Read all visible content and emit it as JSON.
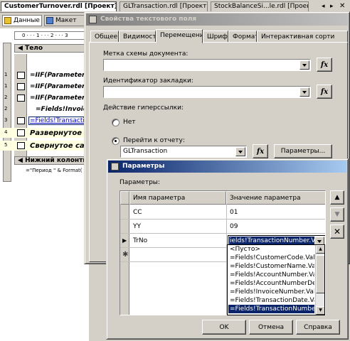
{
  "doc_tabs": [
    "CustomerTurnover.rdl [Проект]",
    "GLTransaction.rdl [Проект]",
    "StockBalanceSi...le.rdl [Проект]"
  ],
  "designer_tabs": [
    "Данные",
    "Макет"
  ],
  "ruler_text": "0 · · · 1 · · · 2 · · · 3",
  "report": {
    "body_label": "Тело",
    "rows": [
      "=IIF(Parameters!C",
      "=IIF(Parameters.",
      "=IIF(Parameters!C",
      "=Fields!InvoiceN",
      "=Fields!Transaction",
      "Развернутое с",
      "Свернутое са"
    ],
    "footer_label": "Нижний колонтит",
    "footer_expr": "=\"Период \" & Format("
  },
  "dialog1": {
    "title": "Свойства текстового поля",
    "tabs": [
      "Общее",
      "Видимость",
      "Перемещение",
      "Шрифт",
      "Формат",
      "Интерактивная сорти"
    ],
    "doc_map_label": "Метка схемы документа:",
    "bookmark_label": "Идентификатор закладки:",
    "hyperlink_label": "Действие гиперссылки:",
    "radio_none": "Нет",
    "radio_goto": "Перейти к отчету:",
    "report_value": "GLTransaction",
    "params_button": "Параметры..."
  },
  "dialog2": {
    "title": "Параметры",
    "params_label": "Параметры:",
    "col_name": "Имя параметра",
    "col_value": "Значение параметра",
    "rows": [
      {
        "name": "CC",
        "value": "01"
      },
      {
        "name": "YY",
        "value": "09"
      },
      {
        "name": "TrNo",
        "value": "ields!TransactionNumber.Value"
      }
    ],
    "dropdown_items": [
      "<Пусто>",
      "=Fields!CustomerCode.Value",
      "=Fields!CustomerName.Value",
      "=Fields!AccountNumber.Value",
      "=Fields!AccountNumberDescripti",
      "=Fields!InvoiceNumber.Value",
      "=Fields!TransactionDate.Value",
      "=Fields!TransactionNumber.Valu"
    ],
    "ok": "OK",
    "cancel": "Отмена",
    "help": "Справка"
  },
  "colors": {
    "title_active": "#0a246a",
    "title_inactive": "#808080",
    "selection": "#0a246a",
    "report_header_bg": "#ffffe1"
  }
}
